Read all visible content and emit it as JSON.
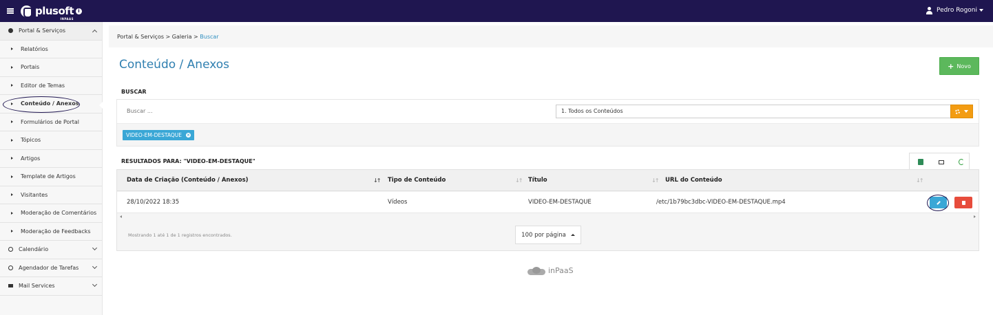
{
  "app": {
    "logo_text": "plusoft",
    "logo_sub": "INPAAS",
    "info_glyph": "i",
    "user_name": "Pedro Rogoni"
  },
  "sidebar": {
    "section": {
      "label": "Portal & Serviços",
      "icon": "globe-icon"
    },
    "items": [
      {
        "label": "Relatórios"
      },
      {
        "label": "Portais"
      },
      {
        "label": "Editor de Temas"
      },
      {
        "label": "Conteúdo / Anexos"
      },
      {
        "label": "Formulários de Portal"
      },
      {
        "label": "Tópicos"
      },
      {
        "label": "Artigos"
      },
      {
        "label": "Template de Artigos"
      },
      {
        "label": "Visitantes"
      },
      {
        "label": "Moderação de Comentários"
      },
      {
        "label": "Moderação de Feedbacks"
      }
    ],
    "bottom": [
      {
        "label": "Calendário",
        "icon": "clock-icon"
      },
      {
        "label": "Agendador de Tarefas",
        "icon": "clock-icon"
      },
      {
        "label": "Mail Services",
        "icon": "mail-icon"
      }
    ]
  },
  "breadcrumb": {
    "path": "Portal & Serviços > Galeria > ",
    "current": "Buscar"
  },
  "page": {
    "title": "Conteúdo / Anexos",
    "new_button": "Novo",
    "new_button_glyph": "+"
  },
  "search": {
    "heading": "BUSCAR",
    "placeholder": "Buscar ...",
    "select_value": "1. Todos os Conteúdos",
    "tag": "VIDEO-EM-DESTAQUE",
    "tag_remove_glyph": "×"
  },
  "results": {
    "heading": "RESULTADOS PARA: \"VIDEO-EM-DESTAQUE\"",
    "columns": [
      "Data de Criação (Conteúdo / Anexos)",
      "Tipo de Conteúdo",
      "Título",
      "URL do Conteúdo"
    ],
    "rows": [
      {
        "date": "28/10/2022 18:35",
        "type": "Vídeos",
        "title": "VIDEO-EM-DESTAQUE",
        "url": "/etc/1b79bc3dbc-VIDEO-EM-DESTAQUE.mp4"
      }
    ],
    "footer_info": "Mostrando 1 até 1 de 1 registros encontrados.",
    "per_page": "100 por página"
  },
  "brand_footer": "inPaaS",
  "colors": {
    "topbar": "#1f1650",
    "accent": "#2f7fb0",
    "success": "#5cb85c",
    "warning": "#f39c12",
    "info": "#3aa7d6",
    "danger": "#e74c3c"
  }
}
